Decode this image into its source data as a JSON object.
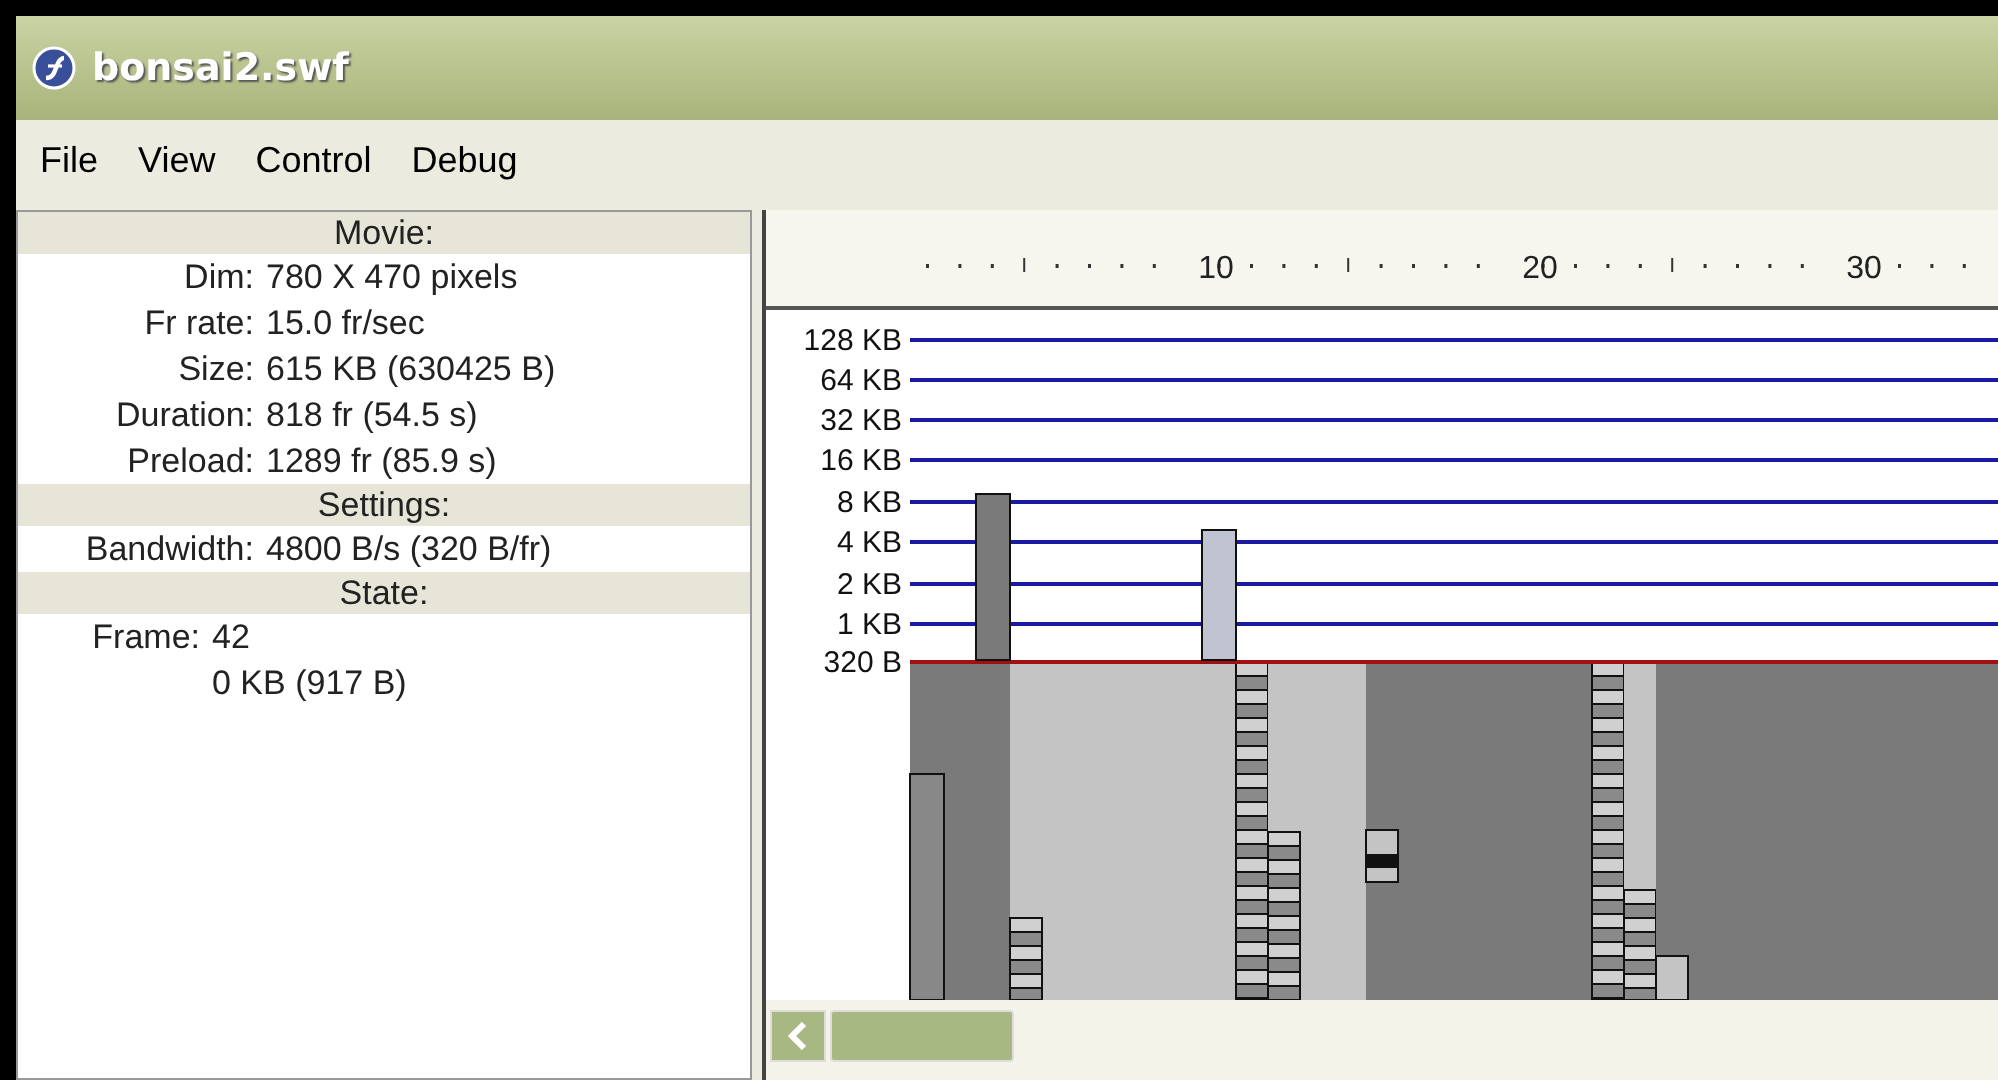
{
  "window": {
    "title": "bonsai2.swf"
  },
  "menu": [
    "File",
    "View",
    "Control",
    "Debug"
  ],
  "sections": [
    {
      "title": "Movie:",
      "kind": "properties",
      "rows": [
        {
          "label": "Dim:",
          "value": "780 X 470 pixels"
        },
        {
          "label": "Fr rate:",
          "value": "15.0 fr/sec"
        },
        {
          "label": "Size:",
          "value": "615 KB (630425 B)"
        },
        {
          "label": "Duration:",
          "value": "818 fr (54.5 s)"
        },
        {
          "label": "Preload:",
          "value": "1289 fr (85.9 s)"
        }
      ]
    },
    {
      "title": "Settings:",
      "kind": "properties",
      "rows": [
        {
          "label": "Bandwidth:",
          "value": "4800 B/s (320 B/fr)"
        }
      ]
    },
    {
      "title": "State:",
      "kind": "state",
      "rows": [
        {
          "label": "Frame:",
          "value": "42"
        },
        {
          "value": "0 KB (917 B)"
        }
      ]
    }
  ],
  "ruler": {
    "labels": [
      "10",
      "20",
      "30"
    ]
  },
  "y_axis": [
    "128 KB",
    "64 KB",
    "32 KB",
    "16 KB",
    "8 KB",
    "4 KB",
    "2 KB",
    "1 KB",
    "320 B"
  ]
}
